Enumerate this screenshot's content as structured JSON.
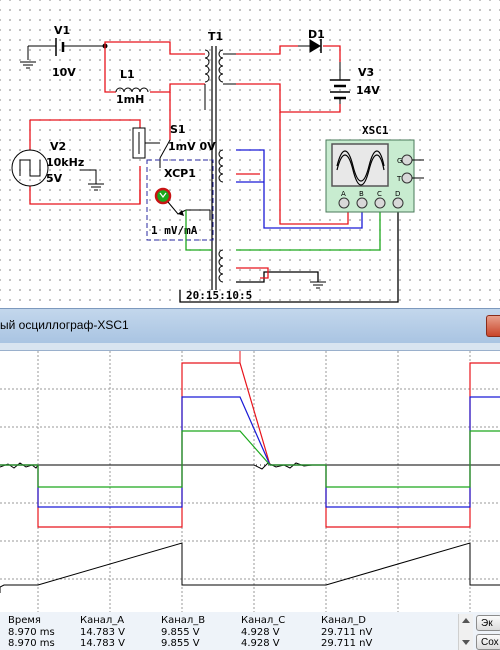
{
  "schematic": {
    "components": {
      "v1": {
        "name": "V1",
        "value": "10V"
      },
      "l1": {
        "name": "L1",
        "value": "1mH"
      },
      "t1": {
        "name": "T1"
      },
      "d1": {
        "name": "D1"
      },
      "v3": {
        "name": "V3",
        "value": "14V"
      },
      "v2": {
        "name": "V2",
        "freq": "10kHz",
        "value": "5V"
      },
      "s1": {
        "name": "S1",
        "value": "1mV 0V"
      },
      "xcp1": {
        "name": "XCP1",
        "value": "1 mV/mA"
      },
      "xsc1": {
        "name": "XSC1",
        "terminals": [
          "A",
          "B",
          "C",
          "D"
        ],
        "side_terminals": [
          "G",
          "T"
        ]
      }
    },
    "turns_ratio": "20:15:10:5"
  },
  "scope_window": {
    "title": "ый осциллограф-XSC1",
    "traces": [
      {
        "name": "Канал_A",
        "color": "#e8141c"
      },
      {
        "name": "Канал_B",
        "color": "#1a1ad6"
      },
      {
        "name": "Канал_C",
        "color": "#1ca81c"
      },
      {
        "name": "Канал_D",
        "color": "#000000"
      }
    ]
  },
  "readout": {
    "headers": [
      "Время",
      "Канал_A",
      "Канал_B",
      "Канал_C",
      "Канал_D"
    ],
    "rows": [
      [
        "8.970 ms",
        "14.783 V",
        "9.855 V",
        "4.928 V",
        "29.711 nV"
      ],
      [
        "8.970 ms",
        "14.783 V",
        "9.855 V",
        "4.928 V",
        "29.711 nV"
      ]
    ],
    "buttons": [
      "Эк",
      "Сох"
    ]
  }
}
